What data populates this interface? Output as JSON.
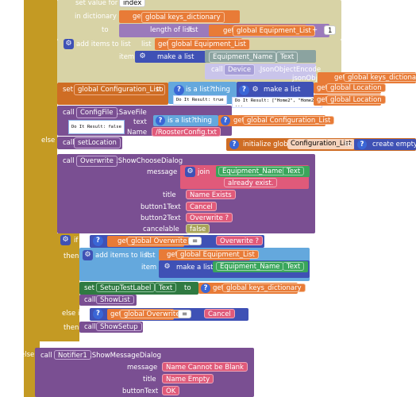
{
  "colors": {
    "gold": "#c49a23",
    "beige": "#d8d3a6",
    "orange_set": "#cf6d24",
    "purple_call": "#7a4f92",
    "purple_dark": "#623b7a",
    "teal_text": "#3aa65b",
    "pink": "#e05a7a",
    "orange_get": "#e87b37",
    "olive": "#a7a259",
    "lightblue": "#64a8dd",
    "blue": "#3f51b5"
  },
  "top": {
    "set_value_for_key": "set value for key",
    "index_value": "index",
    "in_dictionary": "in dictionary",
    "get_global_keys_dictionary": "global keys_dictionary",
    "to": "to",
    "length_of_list": "length of list",
    "list": "list",
    "get_global_equipment_list": "global Equipment_List",
    "plus": "+",
    "one": "1",
    "add_items_to_list": "add items to list",
    "list_label": "list",
    "item_label": "item",
    "make_a_list": "make a list",
    "equipment_name": "Equipment_Name",
    "text_prop": "Text",
    "call": "call",
    "device": "Device",
    "json_object_encode": ".JsonObjectEncode",
    "json_object": "jsonObject",
    "get_keys_dictionary": "global keys_dictionary"
  },
  "config_row": {
    "set": "set",
    "global_configuration_list": "global Configuration_List",
    "to": "to",
    "is_a_list": "is a list?",
    "thing": "thing",
    "make_a_list": "make a list",
    "get": "get",
    "global_location": "global Location",
    "tooltip_true": "Do It Result: true",
    "tooltip_list": "Do It Result: [\"Home2\", \"Home2\"]",
    "tooltip_list2": "..."
  },
  "savefile": {
    "call": "call",
    "configfile": "ConfigFile",
    "savefile": ".SaveFile",
    "text": "text",
    "is_a_list": "is a list?",
    "thing": "thing",
    "get_config": "global Configuration_List",
    "name": "Name",
    "filename": "/RoosterConfig.txt",
    "tooltip_false": "Do It Result: false"
  },
  "setlocation": {
    "call": "call",
    "name": "setLocation",
    "initialize_global": "initialize global",
    "var_name": "Configuration_List",
    "to": "to",
    "create_empty_list": "create empty list"
  },
  "else1": "else",
  "overwrite": {
    "call": "call",
    "component": "Overwrite",
    "method": ".ShowChooseDialog",
    "message_label": "message",
    "join": "join",
    "equipment_name": "Equipment_Name",
    "text_prop": "Text",
    "already_exist": "already exist.",
    "title_label": "title",
    "title_value": "Name Exists",
    "button1_label": "button1Text",
    "button1_value": "Cancel",
    "button2_label": "button2Text",
    "button2_value": "Overwrite ?",
    "cancelable_label": "cancelable",
    "cancelable_value": "false"
  },
  "if_block": {
    "if": "if",
    "get": "get",
    "global_overwrite": "global Overwrite",
    "eq": "=",
    "overwrite_str": "Overwrite ?",
    "then": "then",
    "add_items_to_list": "add items to list",
    "list_label": "list",
    "get_equipment_list": "global Equipment_List",
    "item_label": "item",
    "make_a_list": "make a list",
    "equipment_name": "Equipment_Name",
    "text_prop": "Text",
    "set": "set",
    "setup_test_label": "SetupTestLabel",
    "text_prop2": "Text",
    "to": "to",
    "get_keys_dictionary": "global keys_dictionary",
    "call": "call",
    "show_list": "ShowList",
    "else_if": "else if",
    "global_overwrite2": "global Overwrite",
    "eq2": "=",
    "cancel_str": "Cancel",
    "then2": "then",
    "show_setup": "ShowSetup"
  },
  "else2": "else",
  "notifier": {
    "call": "call",
    "component": "Notifier1",
    "method": ".ShowMessageDialog",
    "message_label": "message",
    "message_value": "Name Cannot be Blank",
    "title_label": "title",
    "title_value": "Name Empty",
    "button_label": "buttonText",
    "button_value": "OK"
  }
}
